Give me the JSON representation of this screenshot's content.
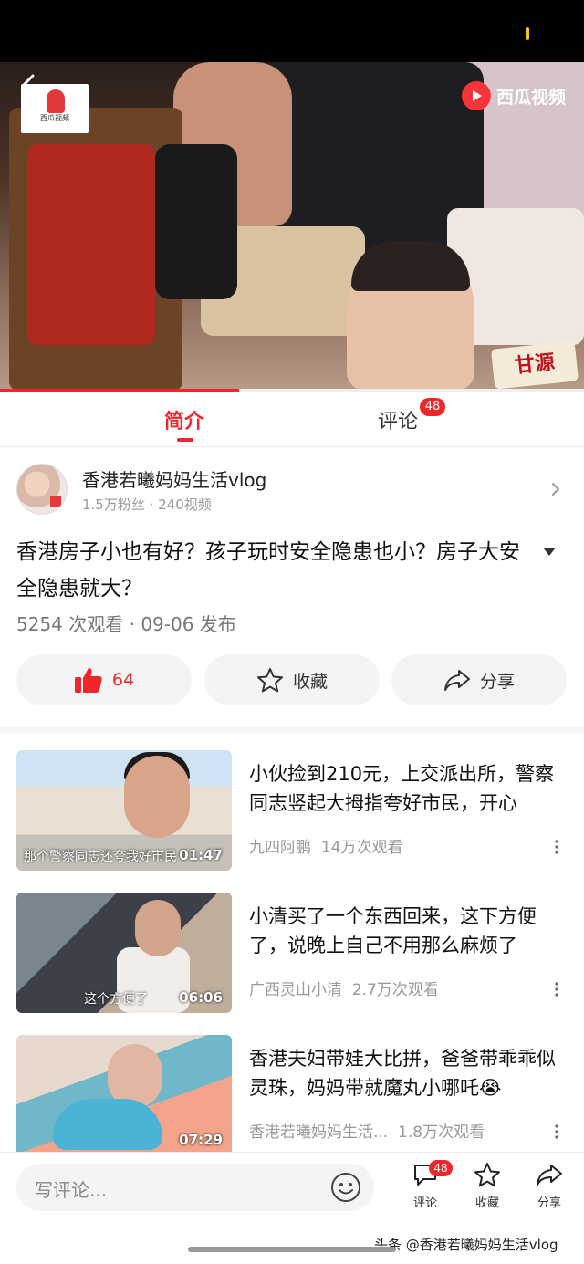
{
  "video": {
    "brand_label": "西瓜视频",
    "logo_label": "西瓜视频",
    "sticker_text": "甘源",
    "progress": 0.41
  },
  "tabs": {
    "intro": "简介",
    "comments": "评论",
    "comments_badge": "48"
  },
  "author": {
    "name": "香港若曦妈妈生活vlog",
    "meta": "1.5万粉丝 · 240视频"
  },
  "video_info": {
    "title": "香港房子小也有好？孩子玩时安全隐患也小？房子大安全隐患就大？",
    "meta": "5254 次观看 · 09-06 发布"
  },
  "actions": {
    "like_count": "64",
    "favorite_label": "收藏",
    "share_label": "分享"
  },
  "recommendations": [
    {
      "title": "小伙捡到210元，上交派出所，警察同志竖起大拇指夸好市民，开心",
      "author": "九四阿鹏",
      "views": "14万次观看",
      "duration": "01:47",
      "caption": "那个警察同志还夸我好市民"
    },
    {
      "title": "小清买了一个东西回来，这下方便了，说晚上自己不用那么麻烦了",
      "author": "广西灵山小清",
      "views": "2.7万次观看",
      "duration": "06:06",
      "caption": "这个方便了"
    },
    {
      "title": "香港夫妇带娃大比拼，爸爸带乖乖似灵珠，妈妈带就魔丸小哪吒😭",
      "author": "香港若曦妈妈生活...",
      "views": "1.8万次观看",
      "duration": "07:29",
      "caption": ""
    }
  ],
  "bottom_bar": {
    "comment_placeholder": "写评论...",
    "comment_label": "评论",
    "comment_badge": "48",
    "favorite_label": "收藏",
    "share_label": "分享",
    "watermark": "头条 @香港若曦妈妈生活vlog"
  },
  "colors": {
    "accent": "#f0262a",
    "muted_text": "#999999"
  },
  "icons": [
    "back-arrow-icon",
    "play-icon",
    "chevron-right-icon",
    "chevron-down-icon",
    "thumbs-up-icon",
    "star-icon",
    "share-icon",
    "more-vertical-icon",
    "emoji-icon",
    "comment-icon"
  ]
}
